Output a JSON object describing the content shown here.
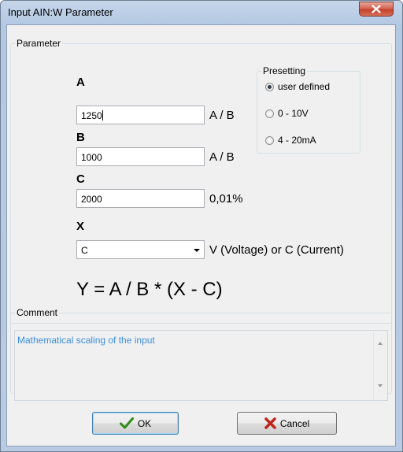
{
  "window": {
    "title": "Input AIN:W Parameter",
    "close_icon": "close-icon"
  },
  "parameter": {
    "legend": "Parameter",
    "a_label": "A",
    "a_value": "1250",
    "a_unit": "A / B",
    "b_label": "B",
    "b_value": "1000",
    "b_unit": "A / B",
    "c_label": "C",
    "c_value": "2000",
    "c_unit": "0,01%",
    "x_label": "X",
    "x_value": "C",
    "x_unit": "V (Voltage) or C (Current)",
    "formula": "Y = A / B * (X - C)"
  },
  "presetting": {
    "legend": "Presetting",
    "options": [
      {
        "label": "user defined",
        "checked": true
      },
      {
        "label": "0 - 10V",
        "checked": false
      },
      {
        "label": "4 - 20mA",
        "checked": false
      }
    ]
  },
  "comment": {
    "legend": "Comment",
    "text": "Mathematical scaling of the input"
  },
  "buttons": {
    "ok": "OK",
    "cancel": "Cancel"
  },
  "colors": {
    "comment_text": "#3c8ede",
    "close_button": "#c3402b",
    "ok_check": "#2f8c17",
    "cancel_x": "#c0231a"
  }
}
